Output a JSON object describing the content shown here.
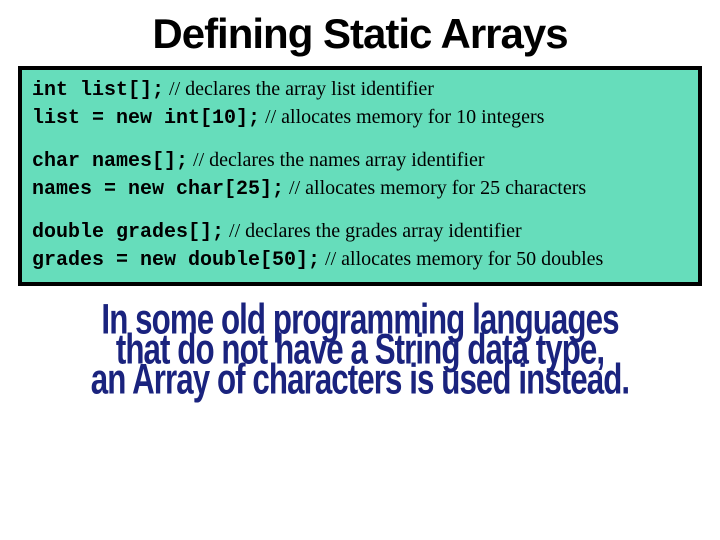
{
  "title": "Defining Static Arrays",
  "code": {
    "g1": {
      "l1c": "int list[];",
      "l1t": "        // declares the array list identifier",
      "l2c": "list = new int[10];",
      "l2t": "     // allocates memory for 10 integers"
    },
    "g2": {
      "l1c": "char names[];",
      "l1t": "      // declares the names array identifier",
      "l2c": "names = new char[25];",
      "l2t": " // allocates memory for 25 characters"
    },
    "g3": {
      "l1c": "double grades[];",
      "l1t": " // declares the grades array identifier",
      "l2c": "grades = new double[50];",
      "l2t": "     // allocates memory for 50 doubles"
    }
  },
  "bottom": {
    "l1": "In some old programming languages",
    "l2": "that do not have a String data type,",
    "l3": "an Array of characters is used instead."
  }
}
